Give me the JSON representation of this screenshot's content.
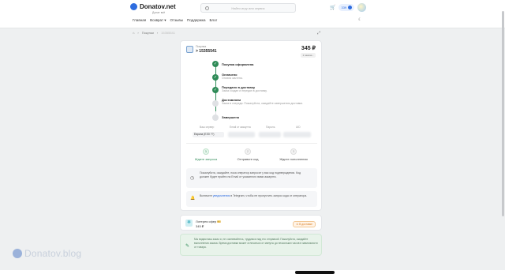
{
  "header": {
    "logo_text": "Donatov.net",
    "logo_sub": "Донат всё",
    "search_placeholder": "Найти игру или сервис",
    "nav": [
      "Главная",
      "Возврат ▾",
      "Отзывы",
      "Поддержка",
      "Блог"
    ],
    "balance": "339",
    "moon_icon": "☾",
    "cart_icon": "🛒"
  },
  "breadcrumb": {
    "home": "⌂",
    "sep": "›",
    "current": "Покупки",
    "last": "15355541"
  },
  "order": {
    "label": "Покупка",
    "id": "> 15355541",
    "price": "345 ₽",
    "badge": "2 заказа ›"
  },
  "timeline": [
    {
      "title": "Покупка оформлена",
      "desc": "",
      "state": "done"
    },
    {
      "title": "Оплачено",
      "desc": "Оплата зачтена.",
      "state": "done"
    },
    {
      "title": "Передано в доставку",
      "desc": "Заказ создан и передан в доставку.",
      "state": "done"
    },
    {
      "title": "Доставляем",
      "desc": "Заказ в очереди. Пожалуйста, ожидайте завершения доставки.",
      "state": "pending"
    },
    {
      "title": "Завершено",
      "desc": "",
      "state": "pending"
    }
  ],
  "fields": {
    "server_label": "Ваш сервер",
    "server_value": "Европа (ЕЭЗ ??)",
    "email_label": "Email от аккаунта",
    "password_label": "Пароль",
    "uid_label": "UID"
  },
  "steps": [
    {
      "num": "1",
      "label": "Ждите запроса",
      "active": true
    },
    {
      "num": "2",
      "label": "Отправьте код",
      "active": false
    },
    {
      "num": "3",
      "label": "Ждите пополнения",
      "active": false
    }
  ],
  "info1": {
    "icon": "◷",
    "text": "Пожалуйста, ожидайте, пока оператор запросит у вас код подтверждения. Код должен будет прийти на Email от указанного вами аккаунта."
  },
  "info2": {
    "icon": "🔔",
    "text_before": "Включите ",
    "link": "уведомления",
    "text_after": " в Telegram, чтобы не пропустить запрос кода от оператора."
  },
  "item": {
    "icon": "❄",
    "name": "Лотерея сфер 🎫",
    "price": "345 ₽",
    "badge": "⊙ В доставке"
  },
  "notice": {
    "icon": "✎",
    "text": "Мы видим ваш заказ и, не сомневайтесь, трудимся над его отправкой. Пожалуйста, ожидайте выполнения заказа. Время доставки может отличаться от минуты до нескольких часов в зависимости от товара."
  },
  "watermark": "Donatov.blog"
}
